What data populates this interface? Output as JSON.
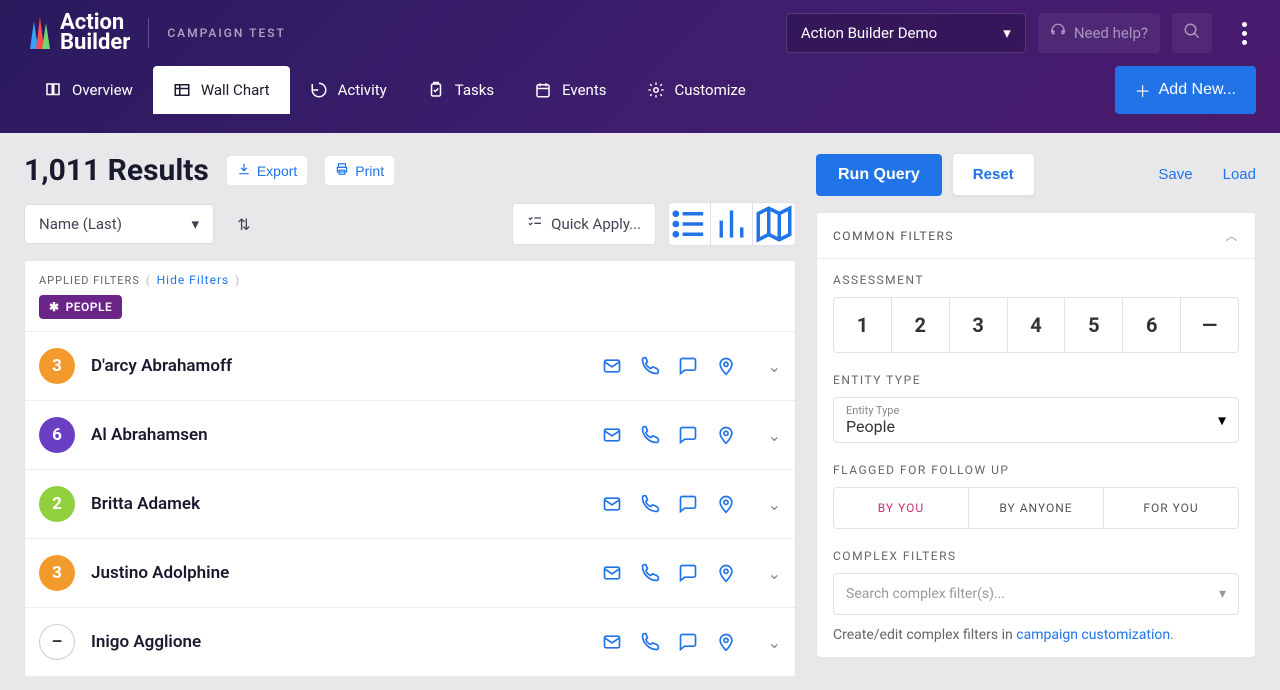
{
  "campaign_label": "CAMPAIGN TEST",
  "logo": {
    "line1": "Action",
    "line2": "Builder"
  },
  "org_select": "Action Builder Demo",
  "help_label": "Need help?",
  "tabs": {
    "overview": "Overview",
    "wallchart": "Wall Chart",
    "activity": "Activity",
    "tasks": "Tasks",
    "events": "Events",
    "customize": "Customize"
  },
  "add_new": "Add New...",
  "results_count": "1,011 Results",
  "export": "Export",
  "print": "Print",
  "sort_field": "Name (Last)",
  "quick_apply": "Quick Apply...",
  "filters_label": "APPLIED FILTERS",
  "hide_filters": "Hide Filters",
  "chip_people": "PEOPLE",
  "people": [
    {
      "badge": "3",
      "color": "#f39a2d",
      "name": "D'arcy Abrahamoff"
    },
    {
      "badge": "6",
      "color": "#6b3fc4",
      "name": "Al Abrahamsen"
    },
    {
      "badge": "2",
      "color": "#8fd03c",
      "name": "Britta Adamek"
    },
    {
      "badge": "3",
      "color": "#f39a2d",
      "name": "Justino Adolphine"
    },
    {
      "badge": "–",
      "color": "#ffffff",
      "name": "Inigo Agglione"
    }
  ],
  "btn_run_query": "Run Query",
  "btn_reset": "Reset",
  "btn_save": "Save",
  "btn_load": "Load",
  "common_filters": "COMMON FILTERS",
  "assessment": "ASSESSMENT",
  "assessment_levels": [
    "1",
    "2",
    "3",
    "4",
    "5",
    "6",
    "—"
  ],
  "entity_type_label": "ENTITY TYPE",
  "entity_type_field": "Entity Type",
  "entity_type_value": "People",
  "flagged_label": "FLAGGED FOR FOLLOW UP",
  "flagged_options": [
    "BY YOU",
    "BY ANYONE",
    "FOR YOU"
  ],
  "complex_filters_label": "COMPLEX FILTERS",
  "complex_placeholder": "Search complex filter(s)...",
  "complex_help_pre": "Create/edit complex filters in ",
  "complex_help_link": "campaign customization",
  "complex_help_post": "."
}
